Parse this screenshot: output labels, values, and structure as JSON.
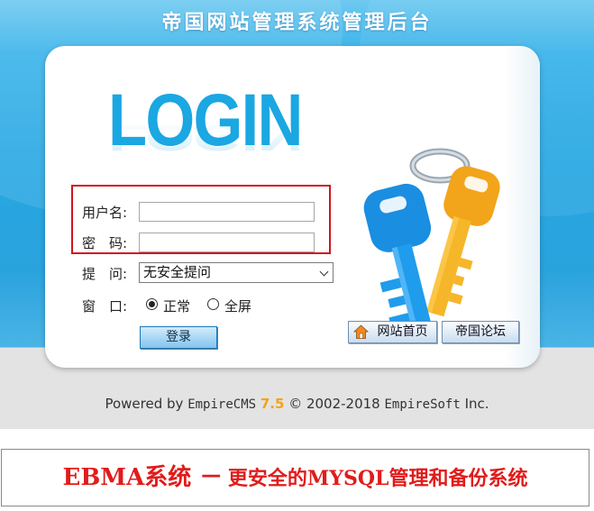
{
  "header": {
    "title": "帝国网站管理系统管理后台"
  },
  "logo": {
    "word": "LOGIN"
  },
  "form": {
    "username_label": "用户名:",
    "username_value": "",
    "password_label": "密　码:",
    "password_value": "",
    "question_label": "提　问:",
    "question_selected": "无安全提问",
    "window_label": "窗　口:",
    "window_options": [
      "正常",
      "全屏"
    ],
    "window_selected": "正常",
    "login_button": "登录"
  },
  "links": {
    "home": "网站首页",
    "forum": "帝国论坛"
  },
  "footer": {
    "powered_by": "Powered by",
    "product": "EmpireCMS",
    "version": "7.5",
    "copyright": "© 2002-2018",
    "company": "EmpireSoft",
    "suffix": "Inc."
  },
  "banner": {
    "part1": "EBMA系统 －",
    "part2": "更安全的MYSQL管理和备份系统"
  },
  "colors": {
    "frame_blue": "#27a7e2",
    "highlight_red": "#d0141c",
    "version_orange": "#f3a319",
    "banner_red": "#e21b1b"
  },
  "icons": {
    "home": "house-icon",
    "keys": "keys-illustration"
  }
}
